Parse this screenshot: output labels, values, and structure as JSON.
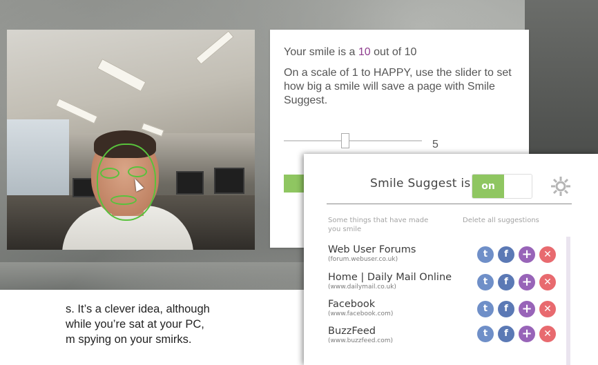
{
  "article": {
    "line1": "s. It’s a clever idea, although",
    "line2": "while you’re sat at your PC,",
    "line3": "m spying on your smirks."
  },
  "settings": {
    "score_prefix": "Your smile is a",
    "score_value": "10",
    "score_suffix": "out of 10",
    "description": "On a scale of 1 to HAPPY, use the slider to set how big a smile will save a page with Smile Suggest.",
    "slider_value": "5",
    "accent_color": "#8e3c8e"
  },
  "popup": {
    "title": "Smile Suggest is",
    "toggle_on_label": "on",
    "toggle_color": "#8fc661",
    "left_header": "Some things that have made you smile",
    "right_header": "Delete all suggestions",
    "sites": [
      {
        "name": "Web User Forums",
        "url": "(forum.webuser.co.uk)"
      },
      {
        "name": "Home | Daily Mail Online",
        "url": "(www.dailymail.co.uk)"
      },
      {
        "name": "Facebook",
        "url": "(www.facebook.com)"
      },
      {
        "name": "BuzzFeed",
        "url": "(www.buzzfeed.com)"
      }
    ]
  }
}
